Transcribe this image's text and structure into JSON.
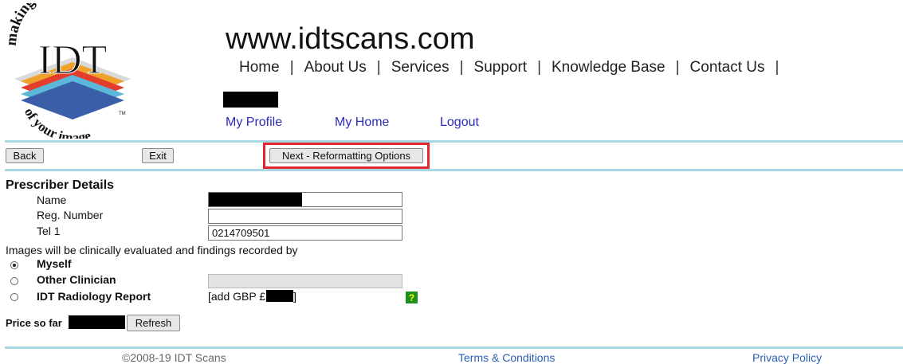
{
  "logo": {
    "arc_top": "making the most",
    "wordmark": "IDT",
    "arc_bottom": "of your image",
    "trademark": "TM"
  },
  "header": {
    "site_title": "www.idtscans.com",
    "nav": [
      "Home",
      "About Us",
      "Services",
      "Support",
      "Knowledge Base",
      "Contact Us"
    ],
    "separator": "|"
  },
  "user_links": {
    "profile": "My Profile",
    "home": "My Home",
    "logout": "Logout"
  },
  "toolbar": {
    "back": "Back",
    "exit": "Exit",
    "next": "Next - Reformatting Options",
    "highlight_color": "#e3262f"
  },
  "prescriber": {
    "heading": "Prescriber Details",
    "name_label": "Name",
    "reg_label": "Reg. Number",
    "tel_label": "Tel 1",
    "name_value": "",
    "reg_value": "",
    "tel_value": "0214709501"
  },
  "evaluation": {
    "question": "Images will be clinically evaluated and findings recorded by",
    "options": [
      {
        "label": "Myself",
        "selected": true
      },
      {
        "label": "Other Clinician",
        "selected": false
      },
      {
        "label": "IDT Radiology Report",
        "selected": false
      }
    ],
    "radiology_fee_prefix": "[add GBP £",
    "radiology_fee_suffix": "]",
    "help_glyph": "?"
  },
  "pricing": {
    "label": "Price so far",
    "refresh": "Refresh"
  },
  "footer": {
    "copyright": "©2008-19 IDT Scans",
    "terms": "Terms & Conditions",
    "privacy": "Privacy Policy"
  },
  "colors": {
    "rule": "#a9d7e4",
    "link": "#2b2bb8",
    "redaction": "#000000"
  }
}
